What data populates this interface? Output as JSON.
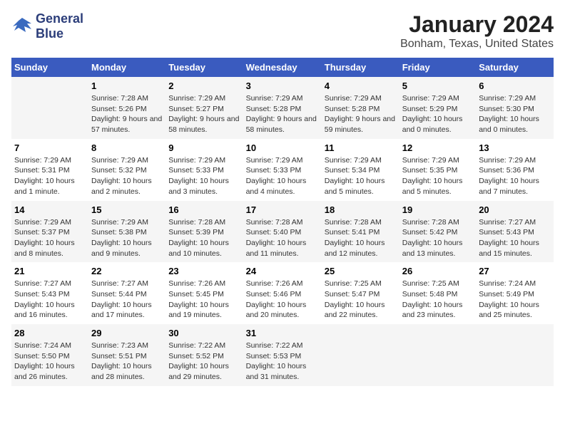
{
  "logo": {
    "line1": "General",
    "line2": "Blue"
  },
  "title": {
    "month": "January 2024",
    "location": "Bonham, Texas, United States"
  },
  "headers": [
    "Sunday",
    "Monday",
    "Tuesday",
    "Wednesday",
    "Thursday",
    "Friday",
    "Saturday"
  ],
  "weeks": [
    [
      {
        "day": "",
        "sunrise": "",
        "sunset": "",
        "daylight": ""
      },
      {
        "day": "1",
        "sunrise": "Sunrise: 7:28 AM",
        "sunset": "Sunset: 5:26 PM",
        "daylight": "Daylight: 9 hours and 57 minutes."
      },
      {
        "day": "2",
        "sunrise": "Sunrise: 7:29 AM",
        "sunset": "Sunset: 5:27 PM",
        "daylight": "Daylight: 9 hours and 58 minutes."
      },
      {
        "day": "3",
        "sunrise": "Sunrise: 7:29 AM",
        "sunset": "Sunset: 5:28 PM",
        "daylight": "Daylight: 9 hours and 58 minutes."
      },
      {
        "day": "4",
        "sunrise": "Sunrise: 7:29 AM",
        "sunset": "Sunset: 5:28 PM",
        "daylight": "Daylight: 9 hours and 59 minutes."
      },
      {
        "day": "5",
        "sunrise": "Sunrise: 7:29 AM",
        "sunset": "Sunset: 5:29 PM",
        "daylight": "Daylight: 10 hours and 0 minutes."
      },
      {
        "day": "6",
        "sunrise": "Sunrise: 7:29 AM",
        "sunset": "Sunset: 5:30 PM",
        "daylight": "Daylight: 10 hours and 0 minutes."
      }
    ],
    [
      {
        "day": "7",
        "sunrise": "Sunrise: 7:29 AM",
        "sunset": "Sunset: 5:31 PM",
        "daylight": "Daylight: 10 hours and 1 minute."
      },
      {
        "day": "8",
        "sunrise": "Sunrise: 7:29 AM",
        "sunset": "Sunset: 5:32 PM",
        "daylight": "Daylight: 10 hours and 2 minutes."
      },
      {
        "day": "9",
        "sunrise": "Sunrise: 7:29 AM",
        "sunset": "Sunset: 5:33 PM",
        "daylight": "Daylight: 10 hours and 3 minutes."
      },
      {
        "day": "10",
        "sunrise": "Sunrise: 7:29 AM",
        "sunset": "Sunset: 5:33 PM",
        "daylight": "Daylight: 10 hours and 4 minutes."
      },
      {
        "day": "11",
        "sunrise": "Sunrise: 7:29 AM",
        "sunset": "Sunset: 5:34 PM",
        "daylight": "Daylight: 10 hours and 5 minutes."
      },
      {
        "day": "12",
        "sunrise": "Sunrise: 7:29 AM",
        "sunset": "Sunset: 5:35 PM",
        "daylight": "Daylight: 10 hours and 5 minutes."
      },
      {
        "day": "13",
        "sunrise": "Sunrise: 7:29 AM",
        "sunset": "Sunset: 5:36 PM",
        "daylight": "Daylight: 10 hours and 7 minutes."
      }
    ],
    [
      {
        "day": "14",
        "sunrise": "Sunrise: 7:29 AM",
        "sunset": "Sunset: 5:37 PM",
        "daylight": "Daylight: 10 hours and 8 minutes."
      },
      {
        "day": "15",
        "sunrise": "Sunrise: 7:29 AM",
        "sunset": "Sunset: 5:38 PM",
        "daylight": "Daylight: 10 hours and 9 minutes."
      },
      {
        "day": "16",
        "sunrise": "Sunrise: 7:28 AM",
        "sunset": "Sunset: 5:39 PM",
        "daylight": "Daylight: 10 hours and 10 minutes."
      },
      {
        "day": "17",
        "sunrise": "Sunrise: 7:28 AM",
        "sunset": "Sunset: 5:40 PM",
        "daylight": "Daylight: 10 hours and 11 minutes."
      },
      {
        "day": "18",
        "sunrise": "Sunrise: 7:28 AM",
        "sunset": "Sunset: 5:41 PM",
        "daylight": "Daylight: 10 hours and 12 minutes."
      },
      {
        "day": "19",
        "sunrise": "Sunrise: 7:28 AM",
        "sunset": "Sunset: 5:42 PM",
        "daylight": "Daylight: 10 hours and 13 minutes."
      },
      {
        "day": "20",
        "sunrise": "Sunrise: 7:27 AM",
        "sunset": "Sunset: 5:43 PM",
        "daylight": "Daylight: 10 hours and 15 minutes."
      }
    ],
    [
      {
        "day": "21",
        "sunrise": "Sunrise: 7:27 AM",
        "sunset": "Sunset: 5:43 PM",
        "daylight": "Daylight: 10 hours and 16 minutes."
      },
      {
        "day": "22",
        "sunrise": "Sunrise: 7:27 AM",
        "sunset": "Sunset: 5:44 PM",
        "daylight": "Daylight: 10 hours and 17 minutes."
      },
      {
        "day": "23",
        "sunrise": "Sunrise: 7:26 AM",
        "sunset": "Sunset: 5:45 PM",
        "daylight": "Daylight: 10 hours and 19 minutes."
      },
      {
        "day": "24",
        "sunrise": "Sunrise: 7:26 AM",
        "sunset": "Sunset: 5:46 PM",
        "daylight": "Daylight: 10 hours and 20 minutes."
      },
      {
        "day": "25",
        "sunrise": "Sunrise: 7:25 AM",
        "sunset": "Sunset: 5:47 PM",
        "daylight": "Daylight: 10 hours and 22 minutes."
      },
      {
        "day": "26",
        "sunrise": "Sunrise: 7:25 AM",
        "sunset": "Sunset: 5:48 PM",
        "daylight": "Daylight: 10 hours and 23 minutes."
      },
      {
        "day": "27",
        "sunrise": "Sunrise: 7:24 AM",
        "sunset": "Sunset: 5:49 PM",
        "daylight": "Daylight: 10 hours and 25 minutes."
      }
    ],
    [
      {
        "day": "28",
        "sunrise": "Sunrise: 7:24 AM",
        "sunset": "Sunset: 5:50 PM",
        "daylight": "Daylight: 10 hours and 26 minutes."
      },
      {
        "day": "29",
        "sunrise": "Sunrise: 7:23 AM",
        "sunset": "Sunset: 5:51 PM",
        "daylight": "Daylight: 10 hours and 28 minutes."
      },
      {
        "day": "30",
        "sunrise": "Sunrise: 7:22 AM",
        "sunset": "Sunset: 5:52 PM",
        "daylight": "Daylight: 10 hours and 29 minutes."
      },
      {
        "day": "31",
        "sunrise": "Sunrise: 7:22 AM",
        "sunset": "Sunset: 5:53 PM",
        "daylight": "Daylight: 10 hours and 31 minutes."
      },
      {
        "day": "",
        "sunrise": "",
        "sunset": "",
        "daylight": ""
      },
      {
        "day": "",
        "sunrise": "",
        "sunset": "",
        "daylight": ""
      },
      {
        "day": "",
        "sunrise": "",
        "sunset": "",
        "daylight": ""
      }
    ]
  ]
}
